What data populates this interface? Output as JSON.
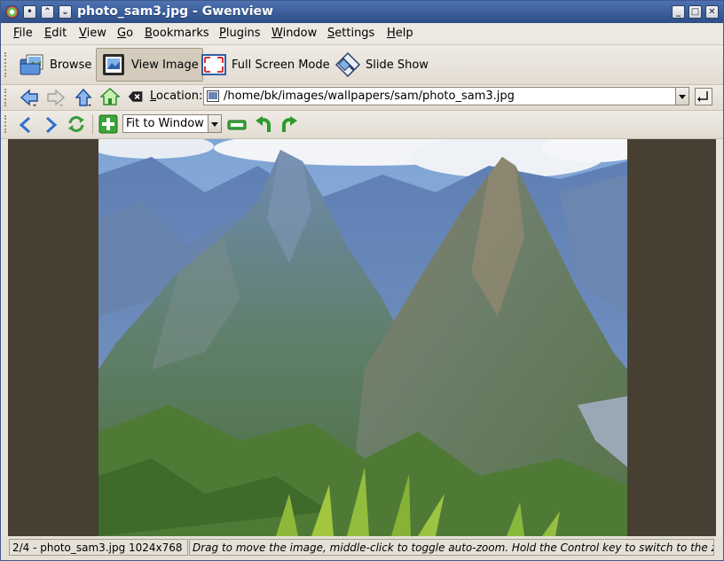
{
  "window": {
    "title": "photo_sam3.jpg - Gwenview"
  },
  "menu": {
    "items": [
      {
        "label": "File",
        "accel": "F",
        "rest": "ile"
      },
      {
        "label": "Edit",
        "accel": "E",
        "rest": "dit"
      },
      {
        "label": "View",
        "accel": "V",
        "rest": "iew"
      },
      {
        "label": "Go",
        "accel": "G",
        "rest": "o"
      },
      {
        "label": "Bookmarks",
        "accel": "B",
        "rest": "ookmarks"
      },
      {
        "label": "Plugins",
        "accel": "P",
        "rest": "lugins"
      },
      {
        "label": "Window",
        "accel": "W",
        "rest": "indow"
      },
      {
        "label": "Settings",
        "accel": "S",
        "rest": "ettings"
      },
      {
        "label": "Help",
        "accel": "H",
        "rest": "elp"
      }
    ]
  },
  "main_toolbar": {
    "browse": "Browse",
    "view_image": "View Image",
    "full_screen": "Full Screen Mode",
    "slide_show": "Slide Show"
  },
  "location_bar": {
    "label_accel": "L",
    "label_rest": "ocation:",
    "path": "/home/bk/images/wallpapers/sam/photo_sam3.jpg"
  },
  "image_toolbar": {
    "zoom_mode": "Fit to Window"
  },
  "status": {
    "file_info": "2/4 - photo_sam3.jpg 1024x768",
    "hint": "Drag to move the image, middle-click to toggle auto-zoom. Hold the Control key to switch to the z"
  },
  "colors": {
    "titlebar": "#3a5d9a",
    "viewer_background": "#474032",
    "accent_green": "#2e9a2e",
    "accent_blue": "#2f6fd1"
  }
}
